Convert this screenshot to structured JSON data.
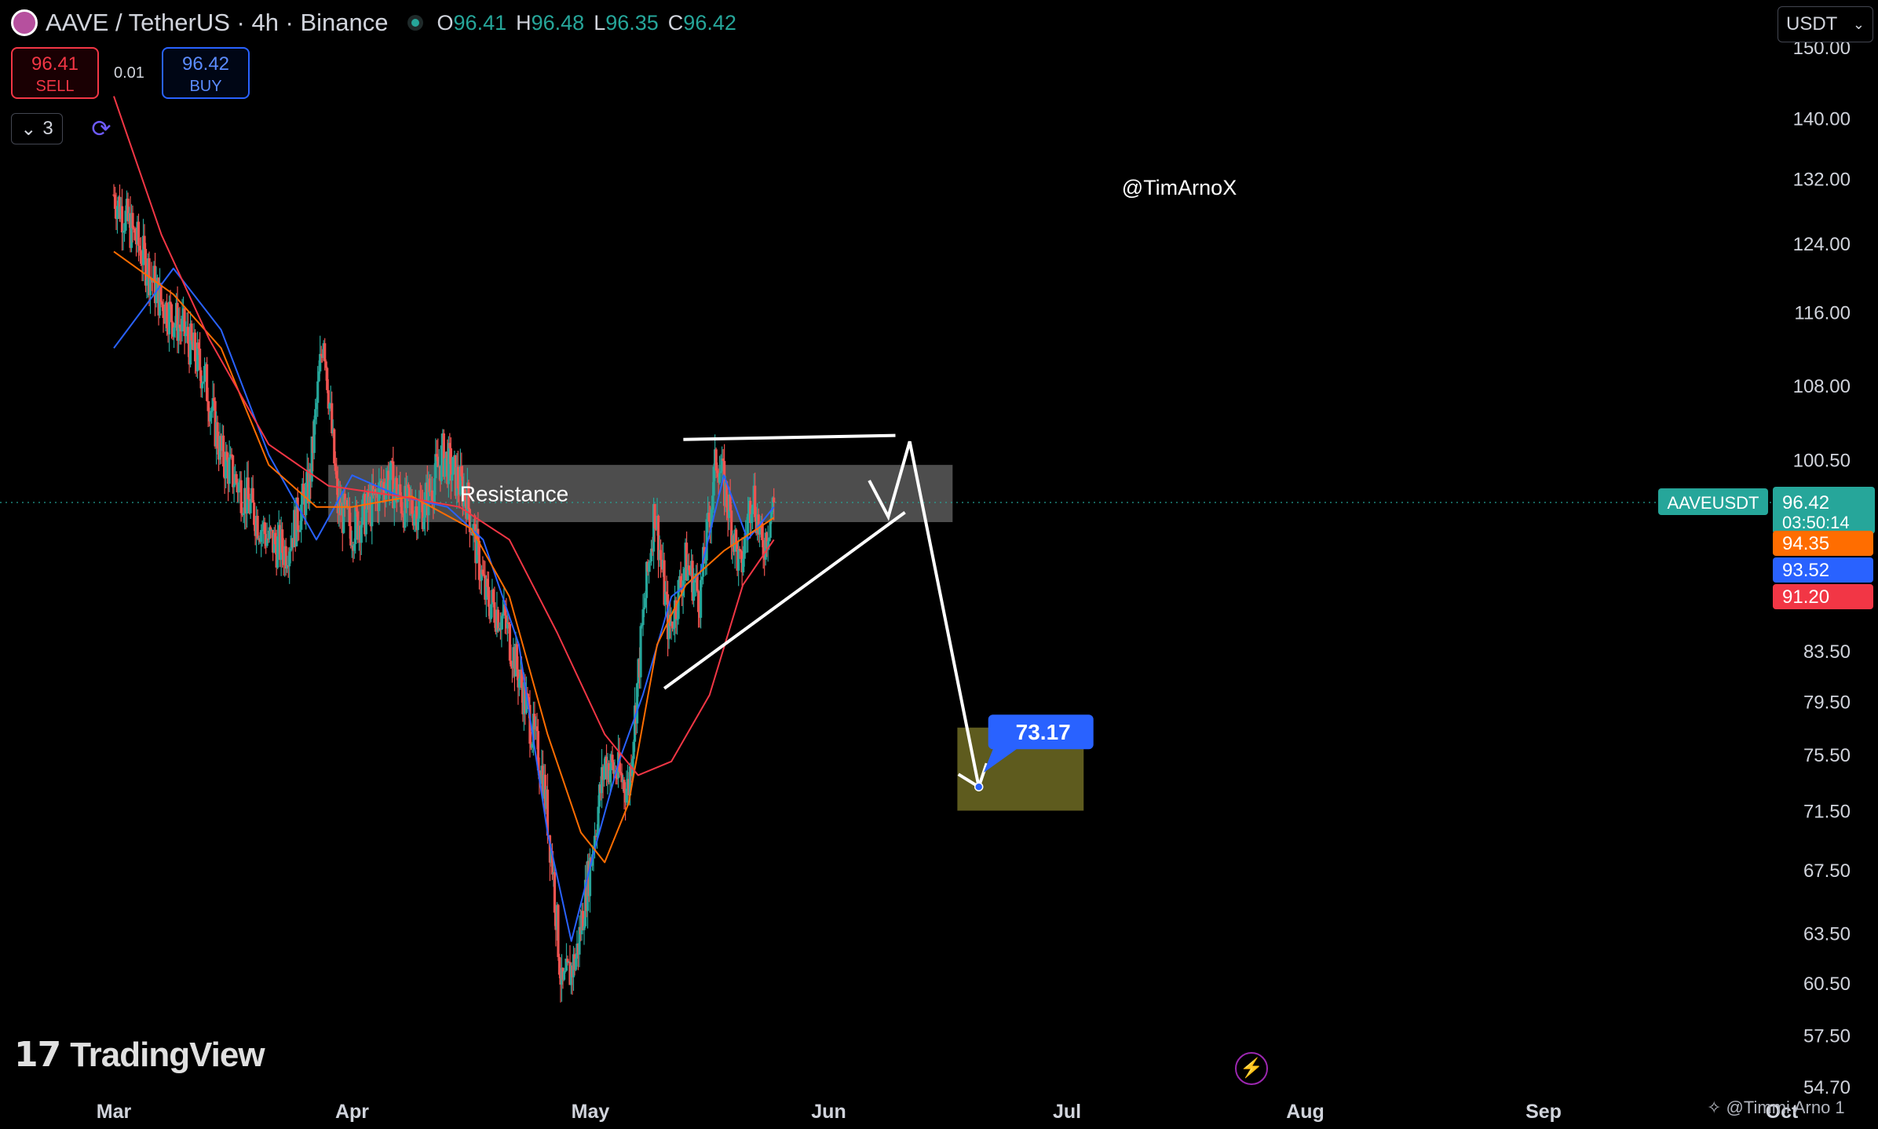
{
  "header": {
    "title": "AAVE / TetherUS · 4h · Binance",
    "ohlc": [
      {
        "k": "O",
        "v": "96.41"
      },
      {
        "k": "H",
        "v": "96.48"
      },
      {
        "k": "L",
        "v": "96.35"
      },
      {
        "k": "C",
        "v": "96.42"
      }
    ]
  },
  "trade": {
    "sell_price": "96.41",
    "sell_label": "SELL",
    "spread": "0.01",
    "buy_price": "96.42",
    "buy_label": "BUY"
  },
  "indicators_count": "3",
  "currency": "USDT",
  "brand": "TradingView",
  "footer_credit": "@Timmi Arno 1",
  "colors": {
    "up": "#26a69a",
    "down": "#ef5350",
    "ma_blue": "#2962ff",
    "ma_orange": "#ff6d00",
    "ma_red": "#f23645",
    "zone": "#5a5a5a",
    "target_zone": "#5e5b1e",
    "target_label": "#2962ff"
  },
  "chart_data": {
    "type": "candlestick",
    "symbol": "AAVEUSDT",
    "timeframe": "4h",
    "scale": "log",
    "x_ticks": [
      "Mar",
      "Apr",
      "May",
      "Jun",
      "Jul",
      "Aug",
      "Sep",
      "Oct"
    ],
    "y_ticks": [
      150.0,
      140.0,
      132.0,
      124.0,
      116.0,
      108.0,
      100.5,
      83.5,
      79.5,
      75.5,
      71.5,
      67.5,
      63.5,
      60.5,
      57.5,
      54.7
    ],
    "ylim": [
      52.5,
      157
    ],
    "price_path": [
      [
        0.0,
        130
      ],
      [
        0.1,
        124
      ],
      [
        0.2,
        117
      ],
      [
        0.29,
        114
      ],
      [
        0.38,
        109
      ],
      [
        0.45,
        101
      ],
      [
        0.55,
        97
      ],
      [
        0.65,
        93
      ],
      [
        0.72,
        92
      ],
      [
        0.82,
        98
      ],
      [
        0.88,
        114
      ],
      [
        0.94,
        96
      ],
      [
        1.0,
        94
      ],
      [
        1.08,
        96
      ],
      [
        1.15,
        99
      ],
      [
        1.22,
        96
      ],
      [
        1.3,
        96
      ],
      [
        1.38,
        101
      ],
      [
        1.48,
        97
      ],
      [
        1.56,
        88
      ],
      [
        1.64,
        86
      ],
      [
        1.72,
        80
      ],
      [
        1.8,
        74
      ],
      [
        1.84,
        68
      ],
      [
        1.88,
        60
      ],
      [
        1.94,
        62
      ],
      [
        2.0,
        68
      ],
      [
        2.06,
        75
      ],
      [
        2.12,
        74
      ],
      [
        2.16,
        73
      ],
      [
        2.22,
        86
      ],
      [
        2.27,
        96
      ],
      [
        2.33,
        85
      ],
      [
        2.4,
        91
      ],
      [
        2.46,
        88
      ],
      [
        2.53,
        101
      ],
      [
        2.58,
        96
      ],
      [
        2.63,
        90
      ],
      [
        2.68,
        98
      ],
      [
        2.72,
        92
      ],
      [
        2.77,
        96.42
      ]
    ],
    "moving_averages": [
      {
        "color": "ma_blue",
        "values": [
          [
            0.0,
            112
          ],
          [
            0.25,
            121
          ],
          [
            0.45,
            114
          ],
          [
            0.65,
            101
          ],
          [
            0.85,
            93
          ],
          [
            1.0,
            99
          ],
          [
            1.2,
            97
          ],
          [
            1.4,
            96
          ],
          [
            1.55,
            93
          ],
          [
            1.7,
            84
          ],
          [
            1.82,
            70
          ],
          [
            1.92,
            63
          ],
          [
            2.02,
            69
          ],
          [
            2.12,
            75
          ],
          [
            2.22,
            80
          ],
          [
            2.34,
            88
          ],
          [
            2.46,
            90
          ],
          [
            2.56,
            99
          ],
          [
            2.66,
            93
          ],
          [
            2.77,
            96
          ]
        ]
      },
      {
        "color": "ma_orange",
        "values": [
          [
            0.0,
            123
          ],
          [
            0.25,
            118
          ],
          [
            0.45,
            112
          ],
          [
            0.65,
            100
          ],
          [
            0.85,
            96
          ],
          [
            1.0,
            96
          ],
          [
            1.25,
            97
          ],
          [
            1.5,
            94
          ],
          [
            1.66,
            88
          ],
          [
            1.82,
            77
          ],
          [
            1.96,
            70
          ],
          [
            2.06,
            68
          ],
          [
            2.16,
            72
          ],
          [
            2.28,
            84
          ],
          [
            2.4,
            89
          ],
          [
            2.56,
            92
          ],
          [
            2.77,
            95
          ]
        ]
      },
      {
        "color": "ma_red",
        "values": [
          [
            0.0,
            143
          ],
          [
            0.2,
            125
          ],
          [
            0.4,
            113
          ],
          [
            0.65,
            102
          ],
          [
            0.9,
            98
          ],
          [
            1.2,
            97
          ],
          [
            1.45,
            96
          ],
          [
            1.66,
            93
          ],
          [
            1.86,
            85
          ],
          [
            2.06,
            77
          ],
          [
            2.2,
            74
          ],
          [
            2.34,
            75
          ],
          [
            2.5,
            80
          ],
          [
            2.64,
            89
          ],
          [
            2.77,
            93
          ]
        ]
      }
    ],
    "last_price": {
      "label": "AAVEUSDT",
      "value": "96.42",
      "countdown": "03:50:14"
    },
    "price_labels": [
      {
        "value": "94.35",
        "color": "ma_orange"
      },
      {
        "value": "93.52",
        "color": "ma_blue"
      },
      {
        "value": "91.20",
        "color": "ma_red"
      }
    ],
    "annotations": {
      "resistance": {
        "label": "Resistance",
        "x": [
          0.9,
          3.52
        ],
        "y": [
          94.6,
          100.0
        ]
      },
      "top_line": {
        "x": [
          2.39,
          3.28
        ],
        "y": [
          102.5,
          102.9
        ]
      },
      "support_line": {
        "x": [
          2.31,
          3.32
        ],
        "y": [
          80.5,
          95.5
        ]
      },
      "path": [
        [
          3.17,
          98.5
        ],
        [
          3.25,
          95.1
        ],
        [
          3.34,
          102.3
        ],
        [
          3.63,
          73.17
        ]
      ],
      "target_zone": {
        "x": [
          3.54,
          4.07
        ],
        "y": [
          71.5,
          77.5
        ]
      },
      "target": {
        "label": "73.17",
        "value": 73.17
      },
      "watermark": "@TimArnoX"
    }
  }
}
